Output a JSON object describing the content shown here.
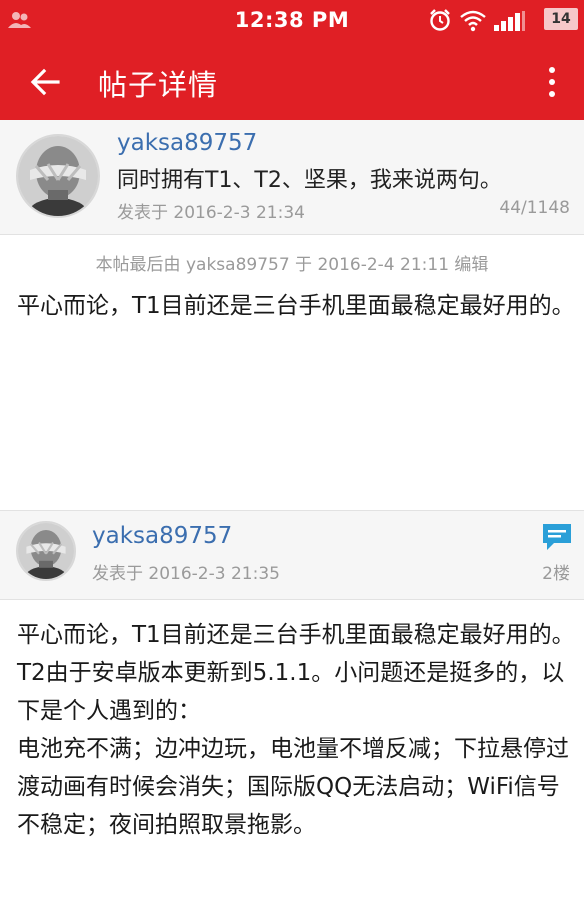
{
  "status_bar": {
    "time": "12:38 PM",
    "battery": "14",
    "icons": [
      "contacts-icon",
      "alarm-icon",
      "wifi-icon",
      "signal-icon",
      "battery-icon"
    ]
  },
  "app_bar": {
    "title": "帖子详情",
    "icons": [
      "back-arrow-icon",
      "more-vert-icon"
    ],
    "background": "#e01f25"
  },
  "original_post": {
    "author": "yaksa89757",
    "title": "同时拥有T1、T2、坚果，我来说两句。",
    "posted": "发表于 2016-2-3 21:34",
    "stats": "44/1148",
    "edit_note": "本帖最后由 yaksa89757 于 2016-2-4 21:11 编辑",
    "body": "平心而论，T1目前还是三台手机里面最稳定最好用的。"
  },
  "reply": {
    "author": "yaksa89757",
    "posted": "发表于 2016-2-3 21:35",
    "floor": "2楼",
    "reply_icon": "comment-icon",
    "paragraphs": [
      "平心而论，T1目前还是三台手机里面最稳定最好用的。",
      "T2由于安卓版本更新到5.1.1。小问题还是挺多的，以下是个人遇到的：",
      "电池充不满；边冲边玩，电池量不增反减；下拉悬停过渡动画有时候会消失；国际版QQ无法启动；WiFi信号不稳定；夜间拍照取景拖影。"
    ]
  },
  "colors": {
    "accent": "#e01f25",
    "username": "#3b6eaf",
    "meta": "#9a9a9a",
    "reply_icon": "#2a9fd8"
  }
}
